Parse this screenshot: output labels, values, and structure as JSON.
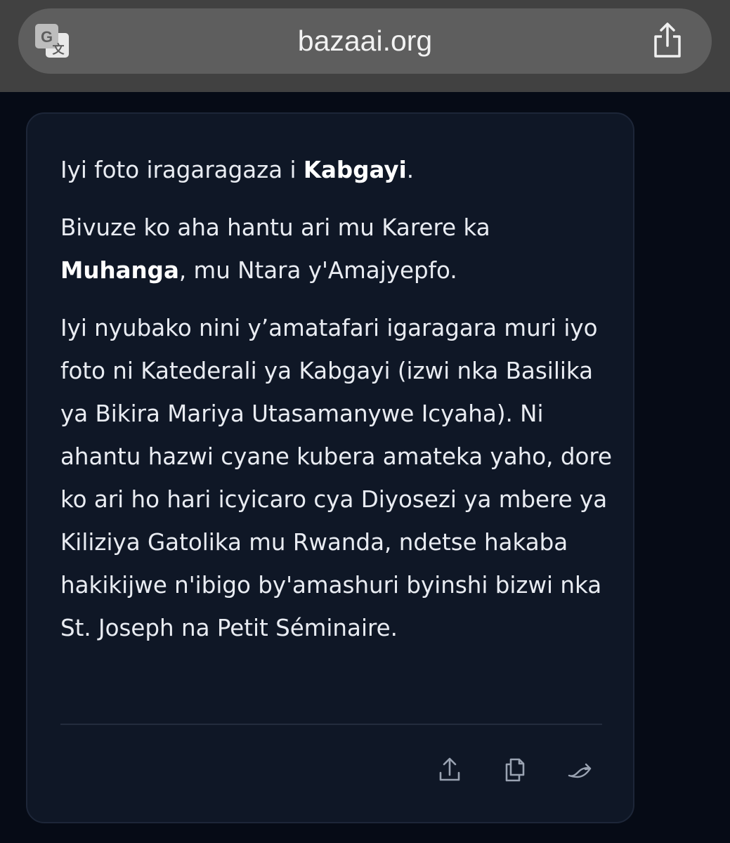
{
  "browser": {
    "url": "bazaai.org",
    "translate_icon": "google-translate-icon",
    "share_icon": "share-icon"
  },
  "message": {
    "p1": {
      "before": "Iyi foto iragaragaza i ",
      "bold": "Kabgayi",
      "after": "."
    },
    "p2": {
      "before": "Bivuze ko aha hantu ari mu Karere ka ",
      "bold": "Muhanga",
      "after": ", mu Ntara y'Amajyepfo."
    },
    "p3": "Iyi nyubako nini y’amatafari igaragara muri iyo foto ni Katederali ya Kabgayi (izwi nka Basilika ya Bikira Mariya Utasamanywe Icyaha). Ni ahantu hazwi cyane kubera amateka yaho, dore ko ari ho hari icyicaro cya Diyosezi ya mbere ya Kiliziya Gatolika mu Rwanda, ndetse hakaba hakikijwe n'ibigo by'amashuri byinshi bizwi nka St. Joseph na Petit Séminaire."
  },
  "actions": {
    "share": "share-icon",
    "copy": "copy-icon",
    "regenerate": "regenerate-icon"
  },
  "colors": {
    "background": "#060b16",
    "card": "#0f1726",
    "topbar": "#414141",
    "urlbar": "#5e5e5e",
    "text": "#e9ecf2",
    "icon": "#9aa3b2"
  }
}
